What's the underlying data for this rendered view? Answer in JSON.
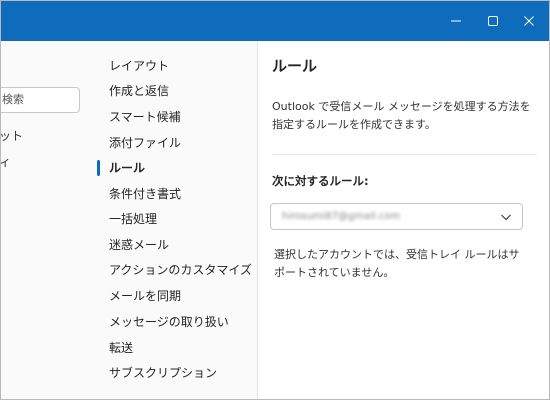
{
  "window": {
    "controls": {
      "minimize_icon": "minimize-icon",
      "maximize_icon": "maximize-icon",
      "close_icon": "close-icon"
    },
    "accent_color": "#0f6cbd"
  },
  "left_panel": {
    "search_text": "検索",
    "items": [
      "ット",
      "ィ"
    ]
  },
  "nav": {
    "items": [
      {
        "label": "レイアウト",
        "active": false
      },
      {
        "label": "作成と返信",
        "active": false
      },
      {
        "label": "スマート候補",
        "active": false
      },
      {
        "label": "添付ファイル",
        "active": false
      },
      {
        "label": "ルール",
        "active": true
      },
      {
        "label": "条件付き書式",
        "active": false
      },
      {
        "label": "一括処理",
        "active": false
      },
      {
        "label": "迷惑メール",
        "active": false
      },
      {
        "label": "アクションのカスタマイズ",
        "active": false
      },
      {
        "label": "メールを同期",
        "active": false
      },
      {
        "label": "メッセージの取り扱い",
        "active": false
      },
      {
        "label": "転送",
        "active": false
      },
      {
        "label": "サブスクリプション",
        "active": false
      }
    ]
  },
  "content": {
    "title": "ルール",
    "description": "Outlook で受信メール メッセージを処理する方法を指定するルールを作成できます。",
    "rules_for_label": "次に対するルール:",
    "account_value": "hirosumi87@gmail.com",
    "note": "選択したアカウントでは、受信トレイ ルールはサポートされていません。"
  }
}
